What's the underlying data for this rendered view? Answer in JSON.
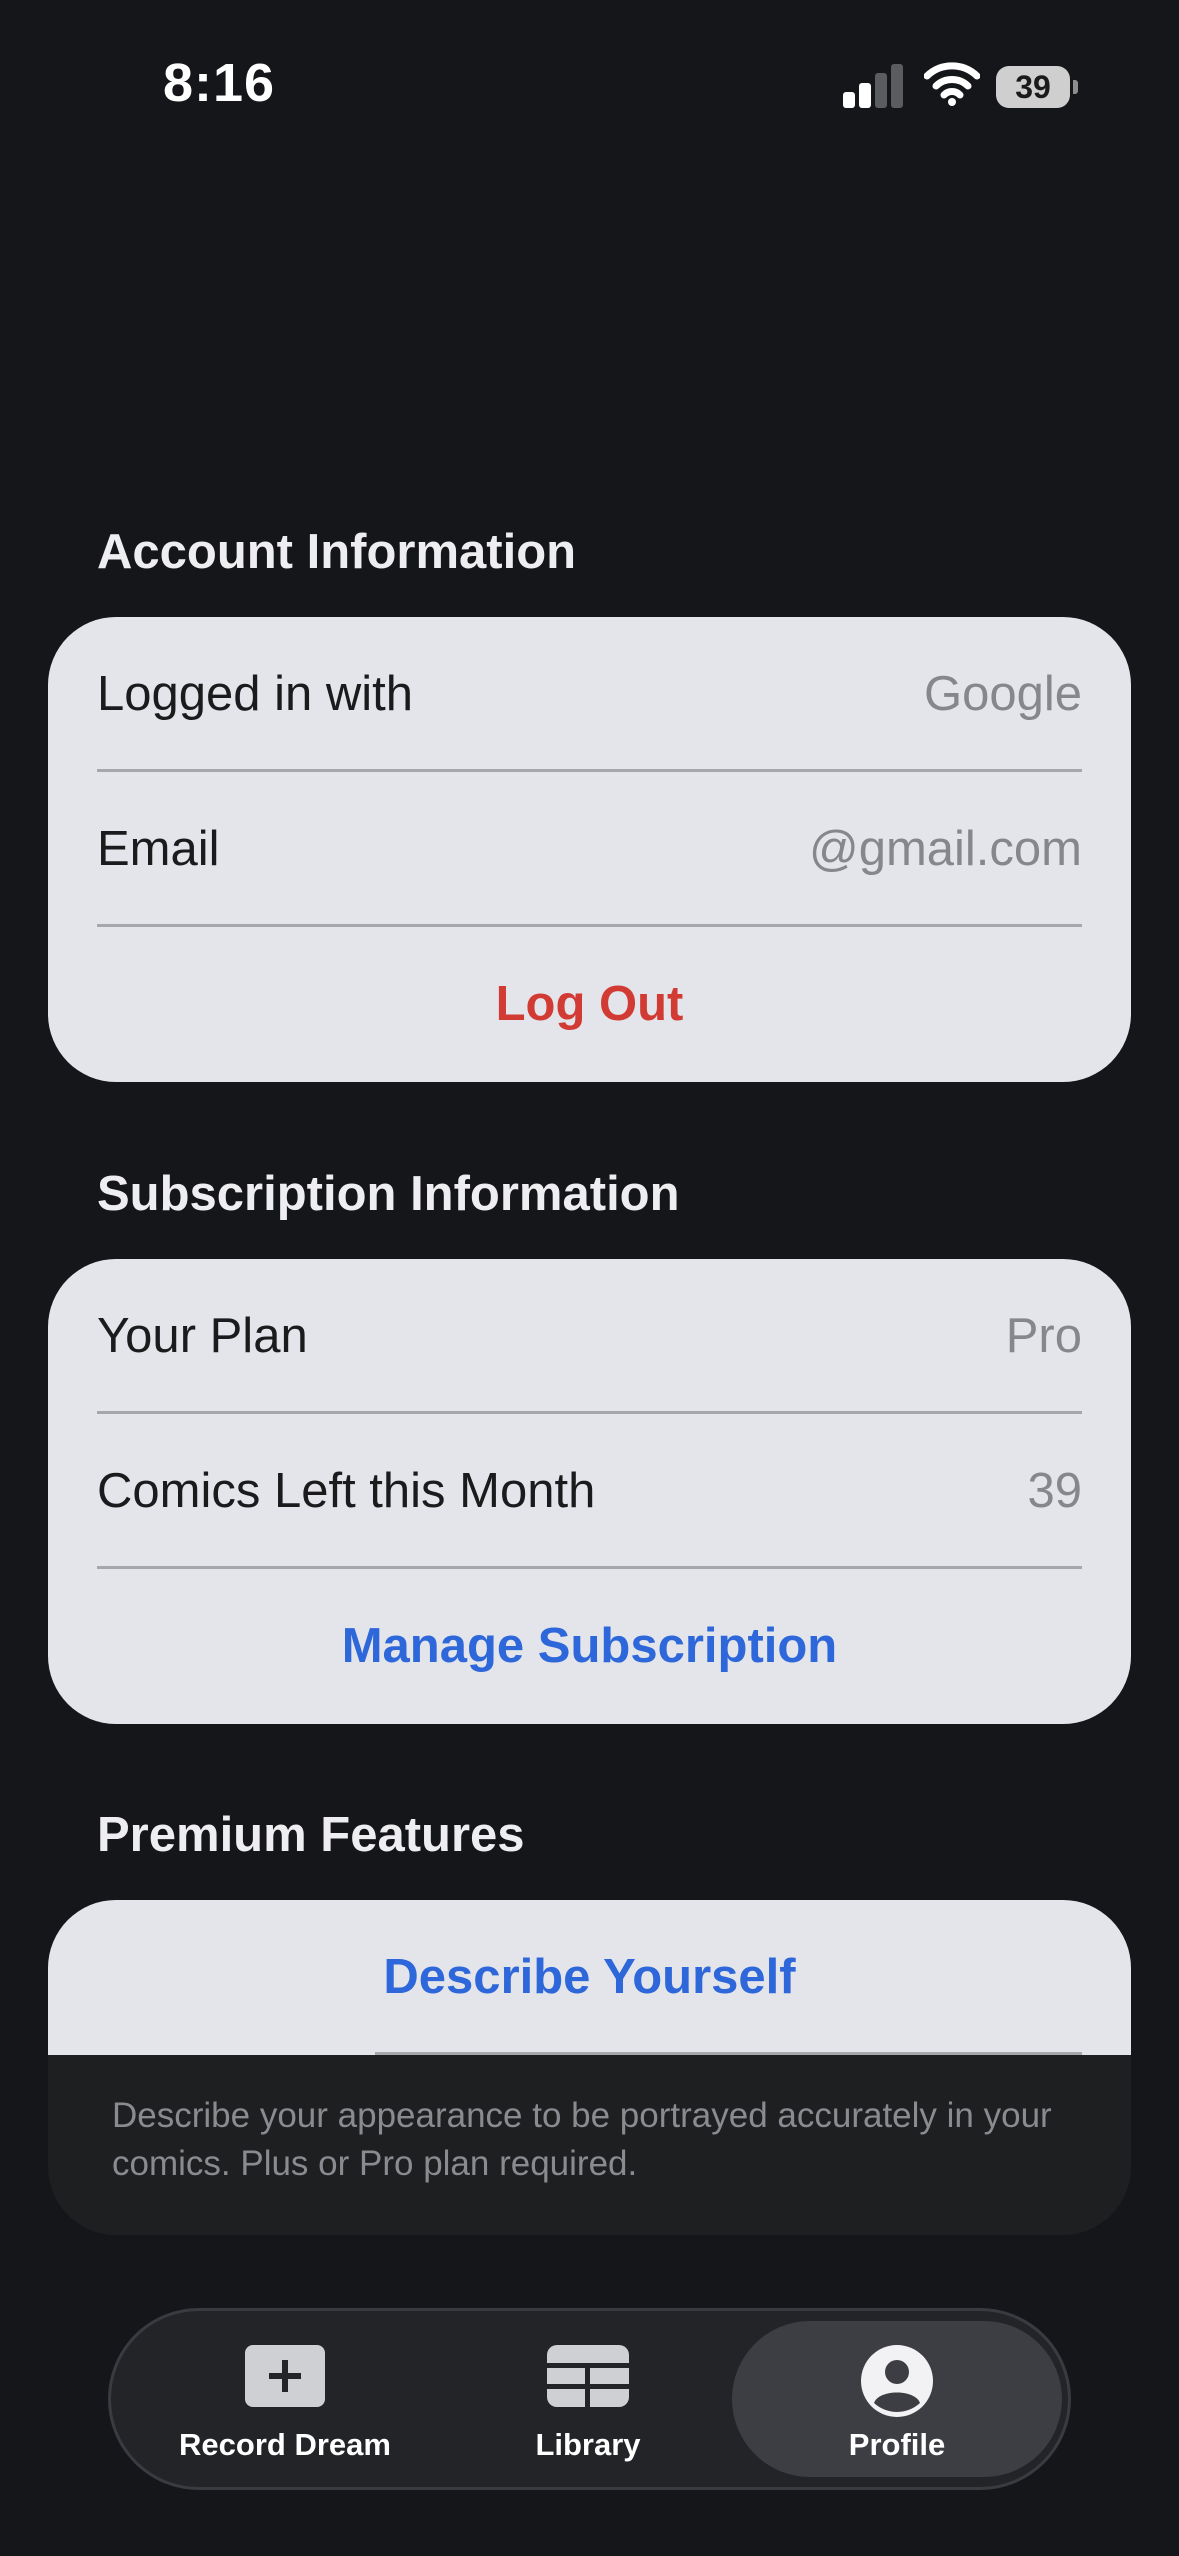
{
  "status_bar": {
    "time": "8:16",
    "battery_percent": "39"
  },
  "account": {
    "title": "Account Information",
    "rows": [
      {
        "label": "Logged in with",
        "value": "Google"
      },
      {
        "label": "Email",
        "value": "@gmail.com"
      }
    ],
    "action_label": "Log Out",
    "action_color": "#d23b34"
  },
  "subscription": {
    "title": "Subscription Information",
    "rows": [
      {
        "label": "Your Plan",
        "value": "Pro"
      },
      {
        "label": "Comics Left this Month",
        "value": "39"
      }
    ],
    "action_label": "Manage Subscription",
    "action_color": "#2e67d9"
  },
  "premium": {
    "title": "Premium Features",
    "action_label": "Describe Yourself",
    "note": "Describe your appearance to be portrayed accurately in your comics. Plus or Pro plan required."
  },
  "tabbar": {
    "tabs": [
      {
        "label": "Record Dream",
        "icon": "plus-square-icon"
      },
      {
        "label": "Library",
        "icon": "grid-icon"
      },
      {
        "label": "Profile",
        "icon": "person-circle-icon",
        "active": true
      }
    ]
  },
  "colors": {
    "background": "#15161a",
    "card": "#e3e5ea",
    "accent_blue": "#2e67d9",
    "destructive_red": "#d23b34"
  }
}
